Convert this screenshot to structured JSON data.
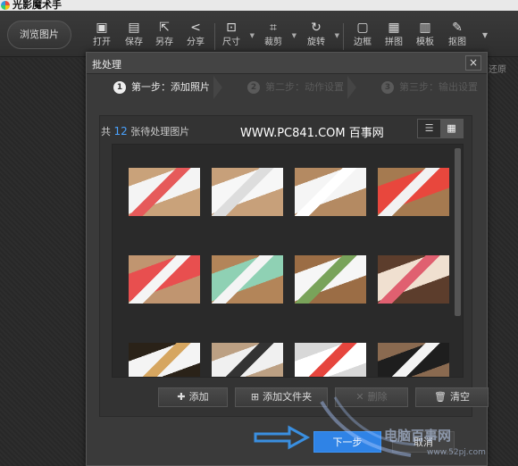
{
  "app": {
    "title": "光影魔术手"
  },
  "toolbar": {
    "browse_label": "浏览图片",
    "tools": [
      {
        "label": "打开",
        "icon": "open-icon"
      },
      {
        "label": "保存",
        "icon": "save-icon"
      },
      {
        "label": "另存",
        "icon": "save-as-icon"
      },
      {
        "label": "分享",
        "icon": "share-icon"
      },
      {
        "label": "尺寸",
        "icon": "resize-icon"
      },
      {
        "label": "裁剪",
        "icon": "crop-icon"
      },
      {
        "label": "旋转",
        "icon": "rotate-icon"
      },
      {
        "label": "边框",
        "icon": "frame-icon"
      },
      {
        "label": "拼图",
        "icon": "collage-icon"
      },
      {
        "label": "模板",
        "icon": "template-icon"
      },
      {
        "label": "抠图",
        "icon": "cutout-icon"
      }
    ],
    "restore_label": "还原"
  },
  "dialog": {
    "title": "批处理",
    "close": "×",
    "steps": [
      {
        "num": "1",
        "label": "第一步：添加照片"
      },
      {
        "num": "2",
        "label": "第二步：动作设置"
      },
      {
        "num": "3",
        "label": "第三步：输出设置"
      }
    ],
    "count_prefix": "共",
    "count": "12",
    "count_suffix": "张待处理图片",
    "watermark": "WWW.PC841.COM 百事网",
    "thumbnails": [
      {
        "colors": [
          "#c9a27a",
          "#f4f4f4",
          "#e65a5a"
        ]
      },
      {
        "colors": [
          "#c7a07a",
          "#f7f7f7",
          "#ddd"
        ]
      },
      {
        "colors": [
          "#b48a62",
          "#f5f5f5",
          "#ffffff"
        ]
      },
      {
        "colors": [
          "#a57a50",
          "#e8473d",
          "#f2f2f2"
        ]
      },
      {
        "colors": [
          "#c09570",
          "#e84f4f",
          "#f5f5f5"
        ]
      },
      {
        "colors": [
          "#b38559",
          "#8fd1b4",
          "#f4f4f4"
        ]
      },
      {
        "colors": [
          "#9b6d45",
          "#f6f6f6",
          "#79a35a"
        ]
      },
      {
        "colors": [
          "#5c3d2c",
          "#f0e0d0",
          "#e06070"
        ]
      },
      {
        "colors": [
          "#2a2218",
          "#f4f4f4",
          "#d6a660"
        ]
      },
      {
        "colors": [
          "#bca083",
          "#f0f0f0",
          "#333"
        ]
      },
      {
        "colors": [
          "#d8d8d8",
          "#ffffff",
          "#e6453d"
        ]
      },
      {
        "colors": [
          "#8a6a50",
          "#1e1e1e",
          "#f4f4f4"
        ]
      }
    ],
    "buttons": {
      "add": "添加",
      "add_folder": "添加文件夹",
      "delete": "删除",
      "clear": "清空"
    },
    "next": "下一步",
    "cancel": "取消"
  },
  "site": {
    "name": "电脑百事网",
    "url": "www.52pj.com"
  }
}
